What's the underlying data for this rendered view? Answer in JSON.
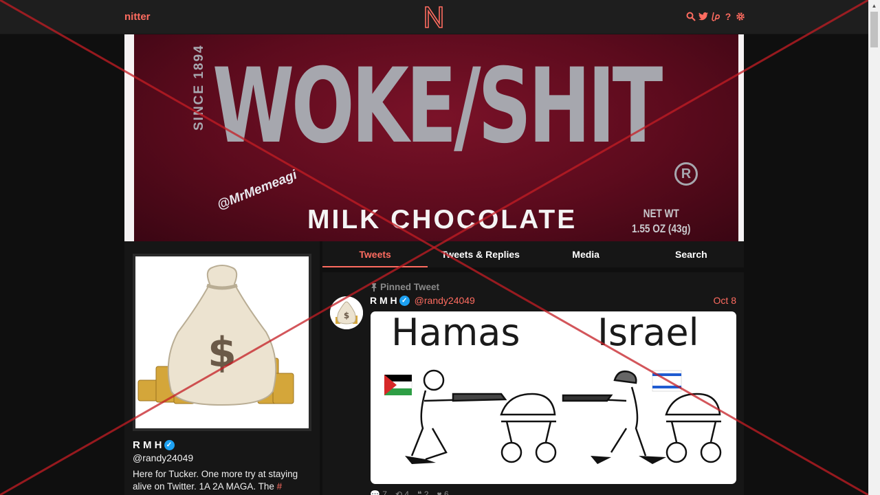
{
  "nav": {
    "brand": "nitter",
    "logo_letter": "N",
    "icons": [
      "search-icon",
      "twitter-bird-icon",
      "liberapay-icon",
      "help-icon",
      "gear-icon"
    ],
    "help_label": "?",
    "accent_color": "#ff6c60"
  },
  "banner": {
    "since_text": "SINCE 1894",
    "title": "WOKE/SHIT",
    "registered": "R",
    "watermark": "@MrMemeagi",
    "subtitle": "MILK CHOCOLATE",
    "net_wt_line1": "NET WT",
    "net_wt_line2": "1.55 OZ (43g)"
  },
  "profile": {
    "fullname": "R M H",
    "username": "@randy24049",
    "bio": "Here for Tucker. One more try at staying alive on Twitter. 1A 2A MAGA. The ",
    "bio_hash": "#"
  },
  "tabs": [
    {
      "label": "Tweets",
      "active": true
    },
    {
      "label": "Tweets & Replies",
      "active": false
    },
    {
      "label": "Media",
      "active": false
    },
    {
      "label": "Search",
      "active": false
    }
  ],
  "tweet": {
    "pinned_label": "Pinned Tweet",
    "fullname": "R M H",
    "handle": "@randy24049",
    "date": "Oct 8",
    "meme_left": "Hamas",
    "meme_right": "Israel",
    "comments": "7",
    "retweets": "4",
    "quotes": "2",
    "likes": "6"
  }
}
